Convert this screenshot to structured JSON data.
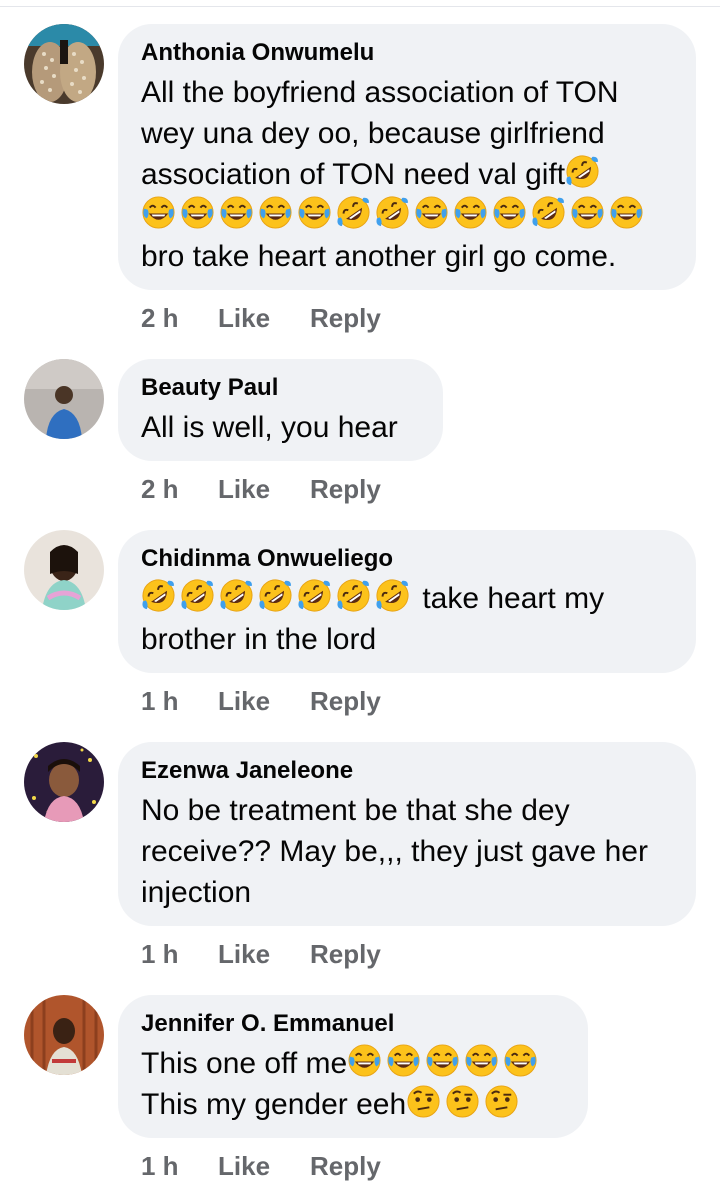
{
  "comments": [
    {
      "author": "Anthonia Onwumelu",
      "lines": [
        "All the boyfriend association of TON",
        "wey una dey oo, because girlfriend",
        "association of TON need val gift",
        "",
        "bro take heart another girl go come."
      ],
      "time": "2 h",
      "like": "Like",
      "reply": "Reply",
      "emoji_row_1_end": [
        "rofl"
      ],
      "emoji_row_2": [
        "joy",
        "joy",
        "joy",
        "joy",
        "joy",
        "rofl",
        "rofl",
        "joy",
        "joy",
        "joy",
        "rofl",
        "joy",
        "joy"
      ]
    },
    {
      "author": "Beauty Paul",
      "lines": [
        "All is well, you hear"
      ],
      "time": "2 h",
      "like": "Like",
      "reply": "Reply"
    },
    {
      "author": "Chidinma Onwueliego",
      "lines": [
        " take heart my",
        "brother in the lord"
      ],
      "time": "1 h",
      "like": "Like",
      "reply": "Reply",
      "emoji_row_1_start": [
        "rofl",
        "rofl",
        "rofl",
        "rofl",
        "rofl",
        "rofl",
        "rofl"
      ]
    },
    {
      "author": "Ezenwa Janeleone",
      "lines": [
        "No be treatment be that she dey",
        "receive?? May be,,, they just gave her",
        "injection"
      ],
      "time": "1 h",
      "like": "Like",
      "reply": "Reply"
    },
    {
      "author": "Jennifer O. Emmanuel",
      "lines": [
        "This one off me",
        "This my gender eeh"
      ],
      "time": "1 h",
      "like": "Like",
      "reply": "Reply",
      "emoji_line_1": [
        "joy",
        "joy",
        "joy",
        "joy",
        "joy"
      ],
      "emoji_line_2": [
        "raised-eyebrow",
        "raised-eyebrow",
        "raised-eyebrow"
      ]
    }
  ],
  "colors": {
    "bubble": "#f0f2f5",
    "meta": "#65676b",
    "text": "#050505",
    "emoji_face": "#fcc21b",
    "emoji_tear": "#40a0ed"
  }
}
